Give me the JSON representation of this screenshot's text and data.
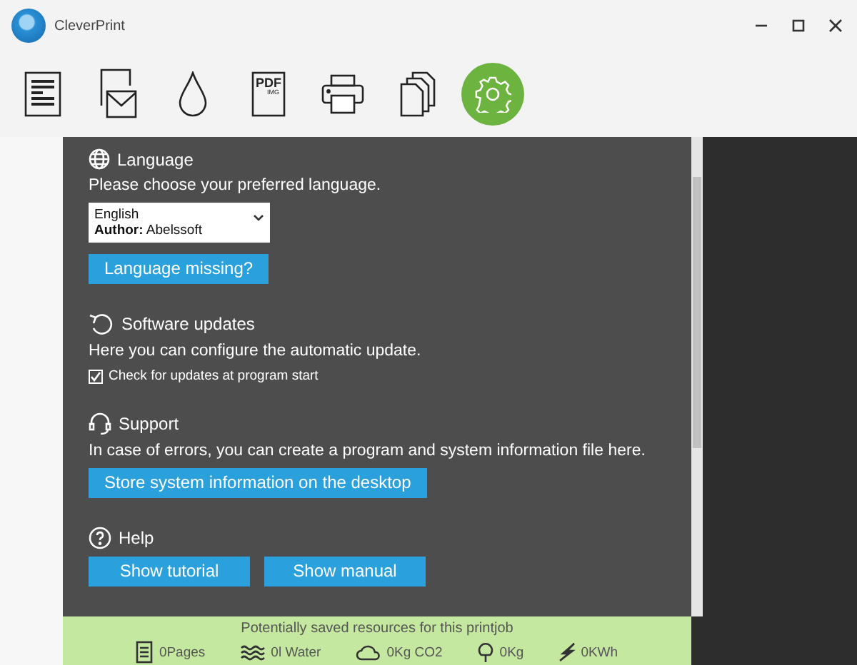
{
  "window": {
    "title": "CleverPrint"
  },
  "toolbar": [
    {
      "kind": "document",
      "selected": false
    },
    {
      "kind": "mail",
      "selected": false
    },
    {
      "kind": "ink",
      "selected": false
    },
    {
      "kind": "pdf",
      "selected": false,
      "label": "PDF",
      "sublabel": "IMG"
    },
    {
      "kind": "printer",
      "selected": false
    },
    {
      "kind": "copies",
      "selected": false
    },
    {
      "kind": "settings",
      "selected": true
    }
  ],
  "sections": [
    {
      "kind": "language",
      "title": "Language",
      "description": "Please choose your preferred language.",
      "dropdown": {
        "value": "English",
        "author_label": "Author:",
        "author": "Abelssoft"
      },
      "buttons": [
        "Language missing?"
      ]
    },
    {
      "kind": "updates",
      "title": "Software updates",
      "description": "Here you can configure the automatic update.",
      "checkbox": {
        "label": "Check for updates at program start",
        "checked": true
      }
    },
    {
      "kind": "support",
      "title": "Support",
      "description": "In case of errors, you can create a program and system information file here.",
      "buttons": [
        "Store system information on the desktop"
      ]
    },
    {
      "kind": "help",
      "title": "Help",
      "buttons": [
        "Show tutorial",
        "Show manual"
      ]
    }
  ],
  "savings": {
    "title": "Potentially saved resources for this printjob",
    "items": [
      {
        "kind": "pages",
        "text": "0Pages"
      },
      {
        "kind": "water",
        "text": "0l Water"
      },
      {
        "kind": "co2",
        "text": "0Kg CO2"
      },
      {
        "kind": "wood",
        "text": "0Kg"
      },
      {
        "kind": "energy",
        "text": "0KWh"
      }
    ]
  }
}
